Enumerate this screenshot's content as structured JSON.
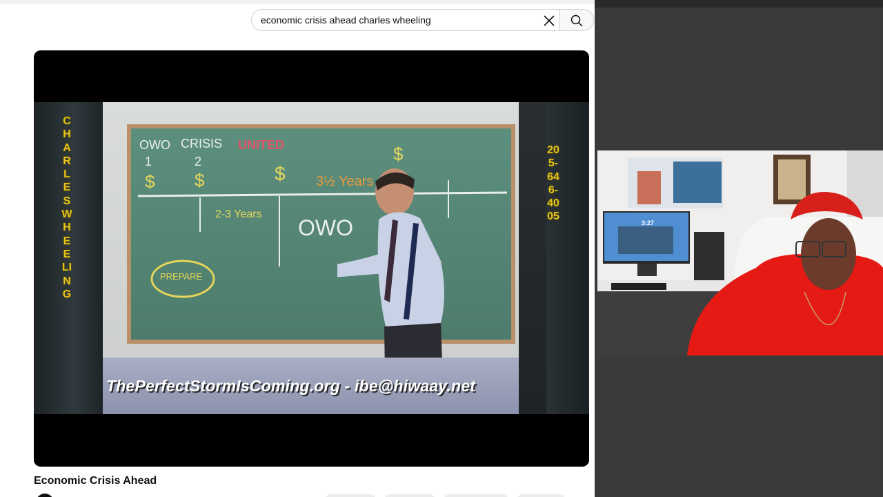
{
  "search": {
    "query": "economic crisis ahead charles wheeling",
    "clear_icon": "close-icon",
    "search_icon": "search-icon"
  },
  "video": {
    "overlay_left_vertical": "CHARLES WHEELING",
    "overlay_right_vertical": "205-646-4005",
    "overlay_bottom": "ThePerfectStormIsComing.org  -  ibe@hiwaay.net",
    "chalkboard": {
      "col1": "OWO",
      "col2": "CRISIS",
      "col3": "UNITED",
      "num1": "1",
      "num2": "2",
      "dollar": "$",
      "years_label": "3½ Years",
      "range": "2-3 Years",
      "owo": "OWO",
      "prepare": "PREPARE"
    },
    "colors": {
      "overlay_text": "#e3c21a",
      "chalk_white": "#e9efe9",
      "chalk_yellow": "#e6d75a",
      "chalk_red": "#e0566a",
      "chalk_orange": "#e79a3a"
    }
  },
  "title": "Economic Crisis Ahead",
  "webcam": {
    "monitor_time": "3:27"
  }
}
